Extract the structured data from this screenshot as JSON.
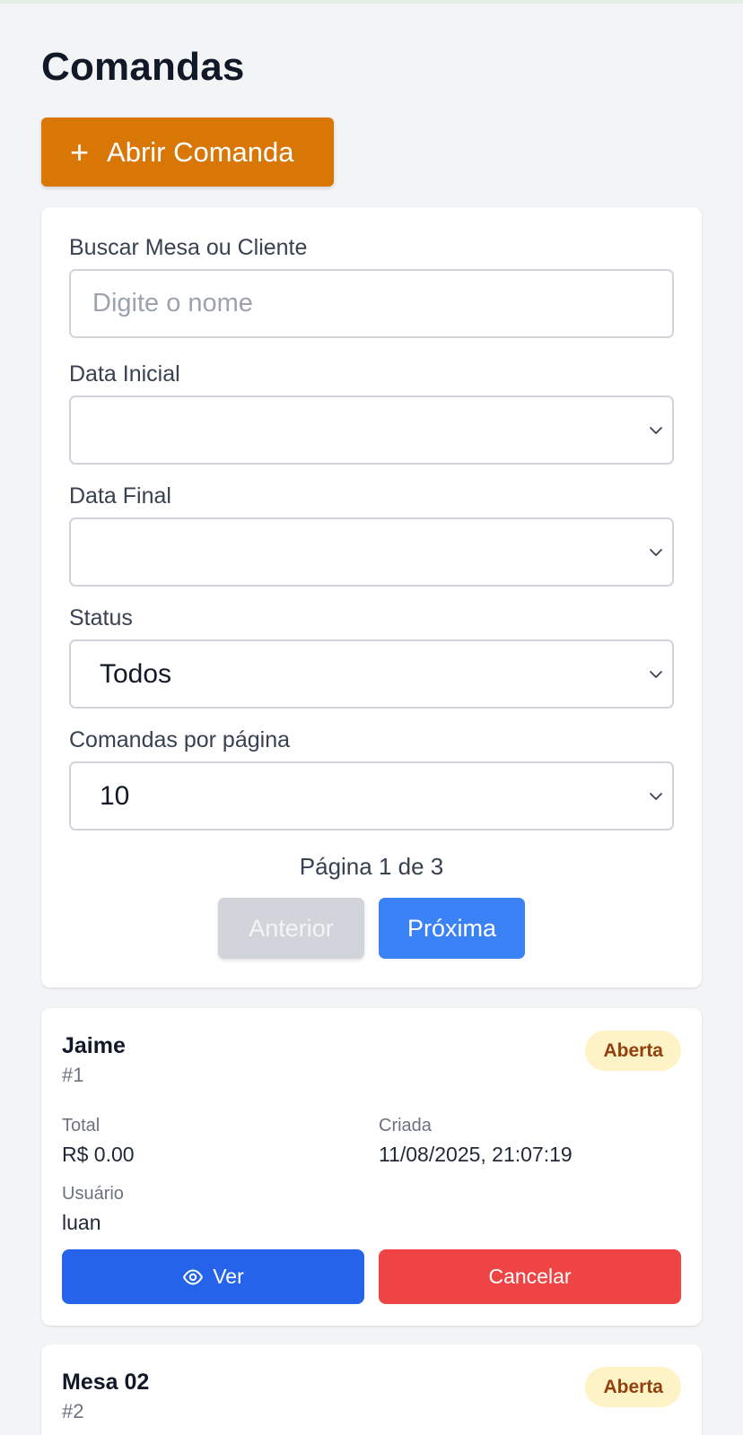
{
  "page": {
    "title": "Comandas"
  },
  "open_button": {
    "label": "Abrir Comanda",
    "icon": "plus-icon"
  },
  "filters": {
    "search_label": "Buscar Mesa ou Cliente",
    "search_placeholder": "Digite o nome",
    "start_date_label": "Data Inicial",
    "start_date_value": "",
    "end_date_label": "Data Final",
    "end_date_value": "",
    "status_label": "Status",
    "status_value": "Todos",
    "per_page_label": "Comandas por página",
    "per_page_value": "10"
  },
  "pagination": {
    "text": "Página 1 de 3",
    "prev_label": "Anterior",
    "next_label": "Próxima"
  },
  "orders": [
    {
      "name": "Jaime",
      "id": "#1",
      "status": "Aberta",
      "total_label": "Total",
      "total": "R$ 0.00",
      "created_label": "Criada",
      "created": "11/08/2025, 21:07:19",
      "user_label": "Usuário",
      "user": "luan",
      "view_label": "Ver",
      "cancel_label": "Cancelar"
    },
    {
      "name": "Mesa 02",
      "id": "#2",
      "status": "Aberta"
    }
  ],
  "colors": {
    "accent_orange": "#d97706",
    "primary_blue": "#3b82f6",
    "view_blue": "#2563eb",
    "danger_red": "#ef4444",
    "badge_bg": "#fef3c7",
    "badge_text": "#92400e"
  }
}
